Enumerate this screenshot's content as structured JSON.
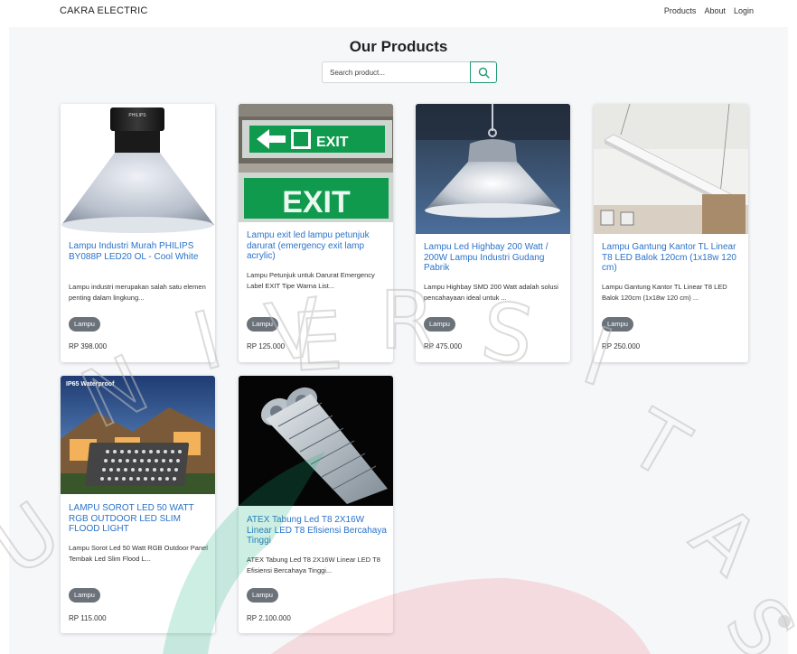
{
  "navbar": {
    "brand": "CAKRA ELECTRIC",
    "links": [
      "Products",
      "About",
      "Login"
    ]
  },
  "page_title": "Our Products",
  "search": {
    "placeholder": "Search product...",
    "button_icon": "search-icon",
    "accent": "#1e9a72"
  },
  "products": [
    {
      "title": "Lampu Industri Murah PHILIPS BY088P LED20 OL - Cool White",
      "description": "Lampu industri merupakan salah satu elemen penting dalam lingkung...",
      "category": "Lampu",
      "price": "RP 398.000",
      "image_brand_text": "PHILIPS"
    },
    {
      "title": "Lampu exit led lampu petunjuk darurat (emergency exit lamp acrylic)",
      "description": "Lampu Petunjuk untuk Darurat Emergency Label EXIT Tipe Warna List...",
      "category": "Lampu",
      "price": "RP 125.000",
      "image_sign_text": "EXIT"
    },
    {
      "title": "Lampu Led Highbay 200 Watt / 200W Lampu Industri Gudang Pabrik",
      "description": "Lampu Highbay SMD 200 Watt adalah solusi pencahayaan ideal untuk ...",
      "category": "Lampu",
      "price": "RP 475.000"
    },
    {
      "title": "Lampu Gantung Kantor TL Linear T8 LED Balok 120cm (1x18w 120 cm)",
      "description": "Lampu Gantung Kantor TL Linear T8 LED Balok 120cm (1x18w 120 cm) ...",
      "category": "Lampu",
      "price": "RP 250.000"
    },
    {
      "title": "LAMPU SOROT LED 50 WATT RGB OUTDOOR LED SLIM FLOOD LIGHT",
      "description": "Lampu Sorot Led 50 Watt RGB Outdoor Panel Tembak Led Slim Flood L...",
      "category": "Lampu",
      "price": "RP 115.000",
      "image_caption": "IP65 Waterproof"
    },
    {
      "title": "ATEX Tabung Led T8 2X16W Linear LED T8 Efisiensi Bercahaya Tinggi",
      "description": "ATEX Tabung Led T8 2X16W Linear LED T8 Efisiensi Bercahaya Tinggi...",
      "category": "Lampu",
      "price": "RP 2.100.000"
    }
  ],
  "watermark_letters": [
    "U",
    "N",
    "I",
    "V",
    "E",
    "R",
    "S",
    "I",
    "T",
    "A",
    "S"
  ]
}
